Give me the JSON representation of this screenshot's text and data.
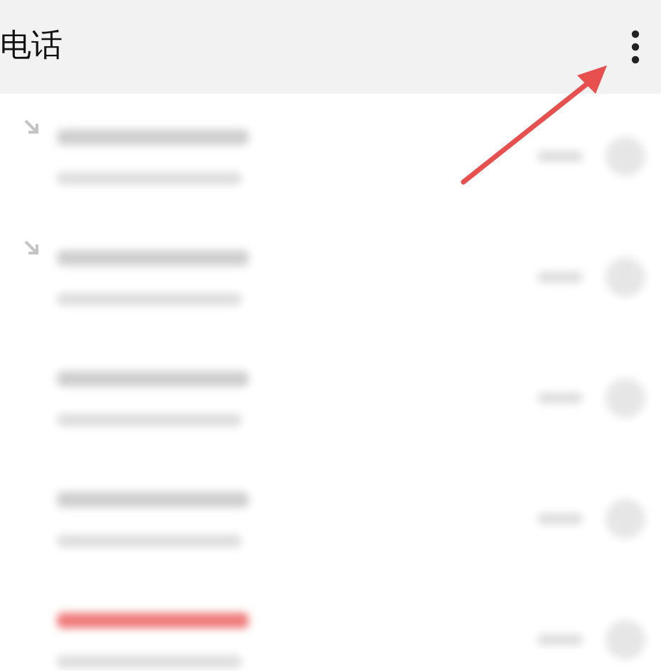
{
  "header": {
    "title": "电话"
  },
  "call_log": [
    {
      "missed": false,
      "marked": true
    },
    {
      "missed": false,
      "marked": true
    },
    {
      "missed": false,
      "marked": false
    },
    {
      "missed": false,
      "marked": false
    },
    {
      "missed": true,
      "marked": false
    }
  ],
  "annotation": {
    "kind": "arrow"
  }
}
